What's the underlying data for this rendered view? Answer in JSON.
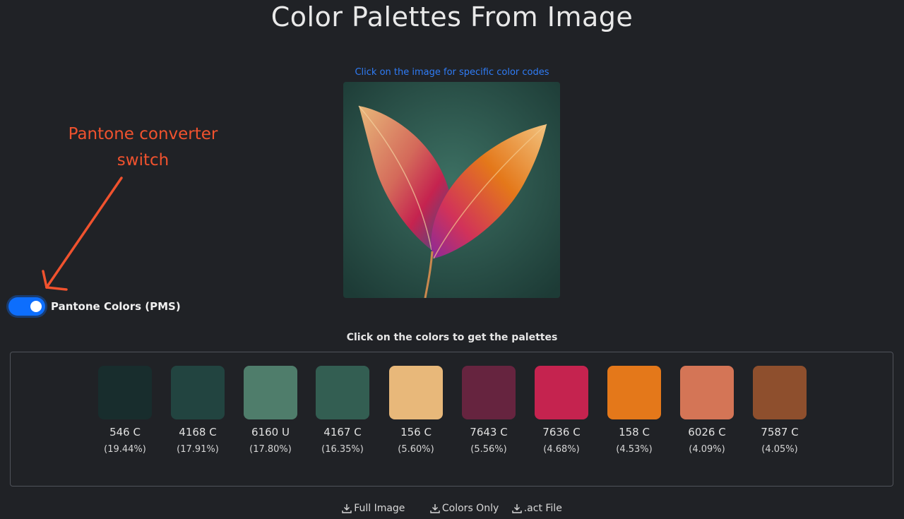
{
  "page": {
    "title": "Color Palettes From Image"
  },
  "image_section": {
    "hint": "Click on the image for specific color codes"
  },
  "annotation": {
    "line1": "Pantone converter",
    "line2": "switch"
  },
  "pantone_toggle": {
    "label": "Pantone Colors (PMS)",
    "checked": true
  },
  "palette": {
    "hint": "Click on the colors to get the palettes",
    "swatches": [
      {
        "code": "546 C",
        "percent": "(19.44%)",
        "color": "#182d2d"
      },
      {
        "code": "4168 C",
        "percent": "(17.91%)",
        "color": "#224440"
      },
      {
        "code": "6160 U",
        "percent": "(17.80%)",
        "color": "#4f7d6b"
      },
      {
        "code": "4167 C",
        "percent": "(16.35%)",
        "color": "#335e52"
      },
      {
        "code": "156 C",
        "percent": "(5.60%)",
        "color": "#e8b87a"
      },
      {
        "code": "7643 C",
        "percent": "(5.56%)",
        "color": "#66243f"
      },
      {
        "code": "7636 C",
        "percent": "(4.68%)",
        "color": "#c5234f"
      },
      {
        "code": "158 C",
        "percent": "(4.53%)",
        "color": "#e4781a"
      },
      {
        "code": "6026 C",
        "percent": "(4.09%)",
        "color": "#d47556"
      },
      {
        "code": "7587 C",
        "percent": "(4.05%)",
        "color": "#8e4f2d"
      }
    ]
  },
  "downloads": {
    "full_image": "Full Image",
    "colors_only": "Colors Only",
    "act_file": ".act File"
  },
  "theme": {
    "accent": "#0d6efd",
    "link": "#2f7cf6",
    "annotation": "#f0522e",
    "background": "#202226"
  }
}
